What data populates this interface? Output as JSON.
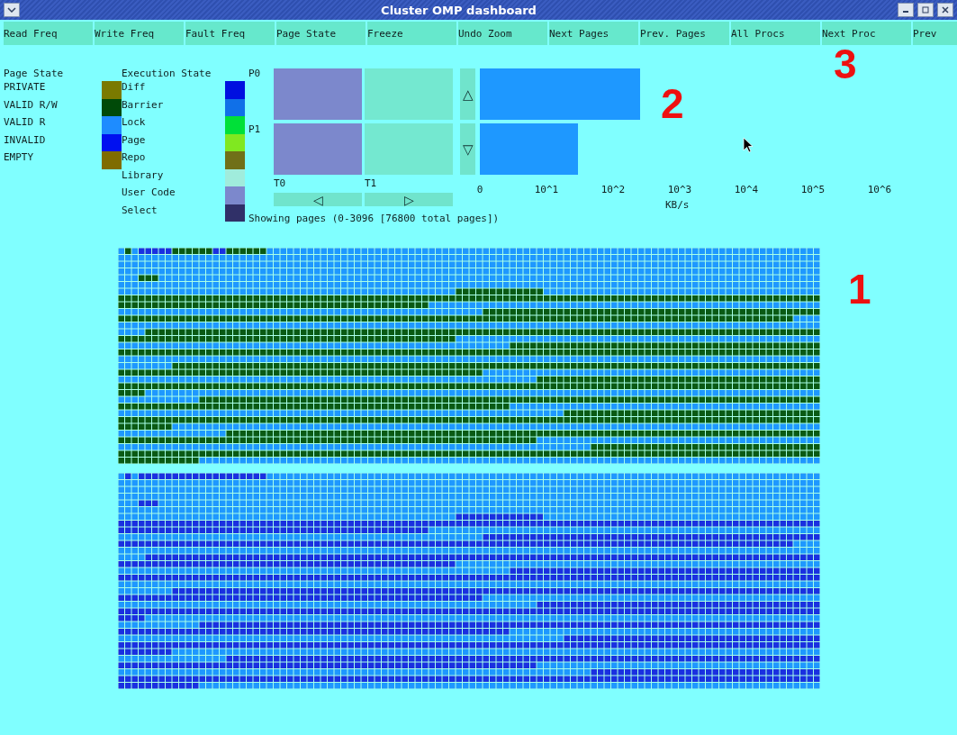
{
  "window": {
    "title": "Cluster OMP dashboard"
  },
  "toolbar": [
    "Read Freq",
    "Write Freq",
    "Fault Freq",
    "Page State",
    "Freeze",
    "Undo Zoom",
    "Next Pages",
    "Prev. Pages",
    "All Procs",
    "Next Proc",
    "Prev"
  ],
  "page_state_legend": {
    "title": "Page State",
    "items": [
      {
        "label": "PRIVATE",
        "color": "#7a7a00"
      },
      {
        "label": "VALID R/W",
        "color": "#004a08"
      },
      {
        "label": "VALID R",
        "color": "#1e8cff"
      },
      {
        "label": "INVALID",
        "color": "#0010f0"
      },
      {
        "label": "EMPTY",
        "color": "#7f6c00"
      }
    ]
  },
  "execution_state_legend": {
    "title": "Execution State",
    "items": [
      {
        "label": "Diff",
        "color": "#0010e0"
      },
      {
        "label": "Barrier",
        "color": "#1070e8"
      },
      {
        "label": "Lock",
        "color": "#00e038"
      },
      {
        "label": "Page",
        "color": "#80e820"
      },
      {
        "label": "Repo",
        "color": "#707018"
      },
      {
        "label": "Library",
        "color": "#a0ecdc"
      },
      {
        "label": "User Code",
        "color": "#7c88cc"
      },
      {
        "label": "Select",
        "color": "#303068"
      }
    ]
  },
  "thread_view": {
    "rows": [
      {
        "label": "P0",
        "cells": [
          {
            "color": "#7c88cc"
          },
          {
            "color": "#74e8d0"
          }
        ]
      },
      {
        "label": "P1",
        "cells": [
          {
            "color": "#7c88cc"
          },
          {
            "color": "#74e8d0"
          }
        ]
      }
    ],
    "columns": [
      "T0",
      "T1"
    ],
    "scroll_up": "△",
    "scroll_down": "▽",
    "scroll_left": "◁",
    "scroll_right": "▷"
  },
  "bandwidth": {
    "axis_ticks": [
      "0",
      "10^1",
      "10^2",
      "10^3",
      "10^4",
      "10^5",
      "10^6"
    ],
    "axis_label": "KB/s"
  },
  "status": "Showing pages (0-3096 [76800 total pages])",
  "page_maps": [
    {
      "color": "#0a5a14"
    },
    {
      "color": "#1a30e0"
    }
  ],
  "annotations": [
    "1",
    "2",
    "3"
  ]
}
